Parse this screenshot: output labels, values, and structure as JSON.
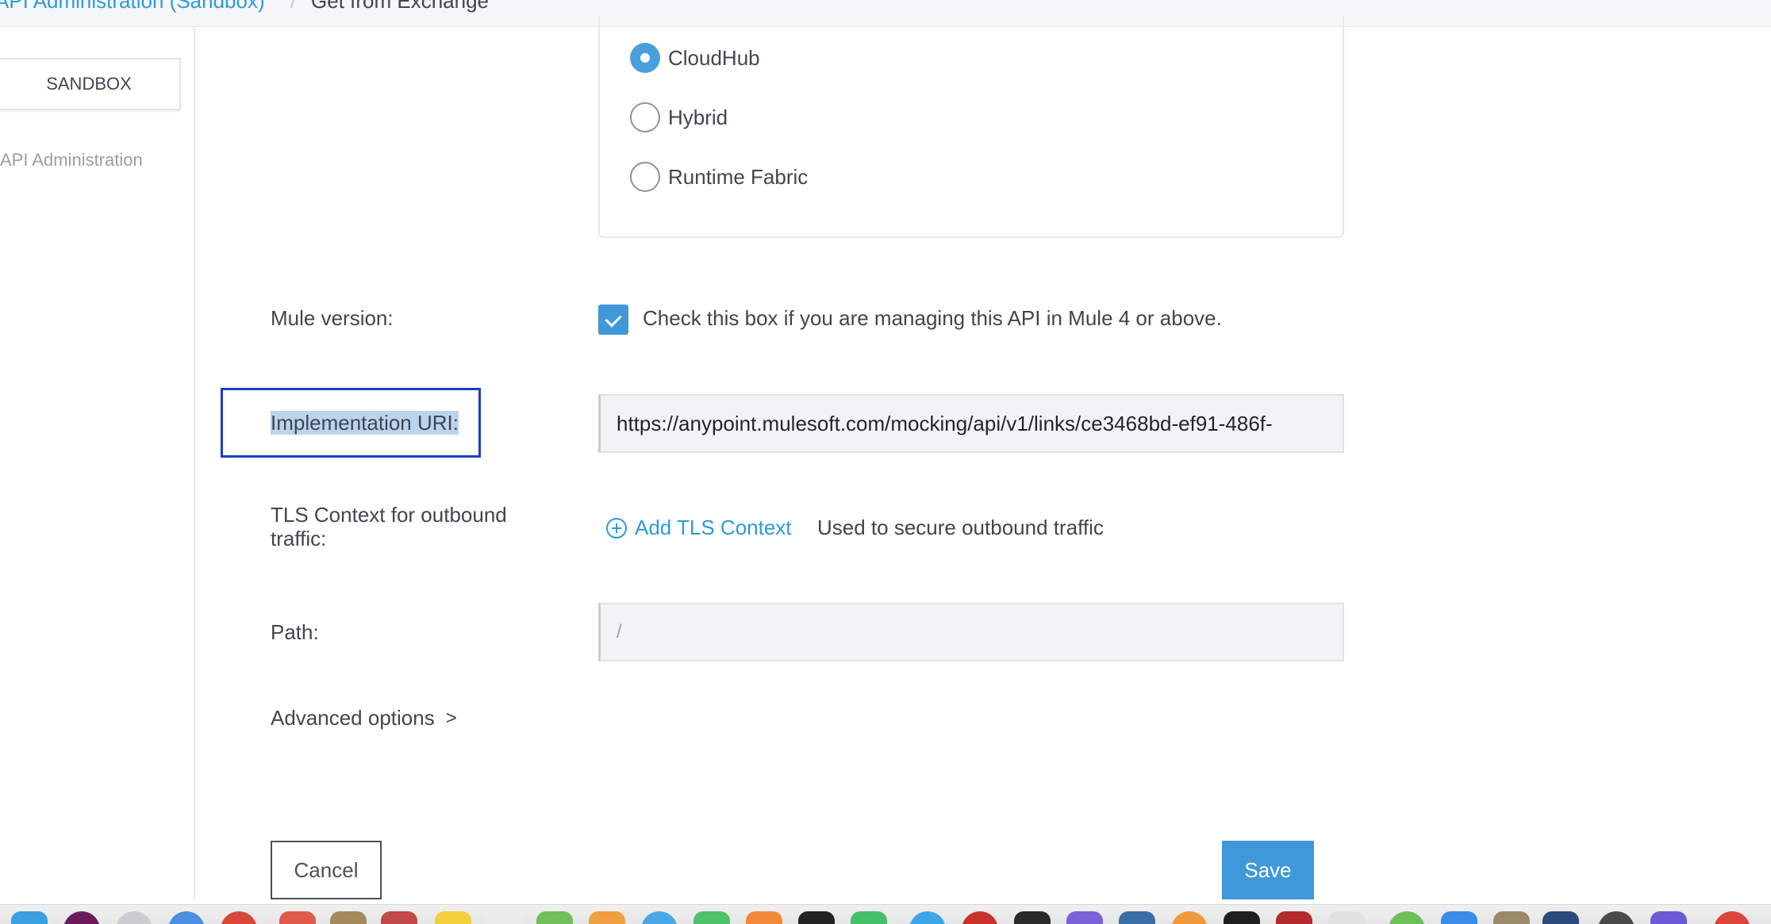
{
  "breadcrumb": {
    "parent": "API Administration (Sandbox)",
    "separator": "/",
    "current": "Get from Exchange"
  },
  "sidebar": {
    "environment": "SANDBOX",
    "nav_item": "API Administration"
  },
  "runtime": {
    "options": [
      {
        "label": "CloudHub",
        "selected": true
      },
      {
        "label": "Hybrid",
        "selected": false
      },
      {
        "label": "Runtime Fabric",
        "selected": false
      }
    ]
  },
  "mule_version": {
    "label": "Mule version:",
    "checkbox_text": "Check this box if you are managing this API in Mule 4 or above.",
    "checked": true
  },
  "implementation_uri": {
    "label": "Implementation URI:",
    "value": "https://anypoint.mulesoft.com/mocking/api/v1/links/ce3468bd-ef91-486f-"
  },
  "tls": {
    "label_line1": "TLS Context for outbound",
    "label_line2": "traffic:",
    "link": "Add TLS Context",
    "help": "Used to secure outbound traffic"
  },
  "path": {
    "label": "Path:",
    "placeholder": "/"
  },
  "advanced": {
    "label": "Advanced options",
    "chevron": ">"
  },
  "actions": {
    "cancel": "Cancel",
    "save": "Save"
  },
  "colors": {
    "accent": "#3f98d8",
    "link": "#2d9bd8",
    "focus": "#1d3bc9"
  }
}
